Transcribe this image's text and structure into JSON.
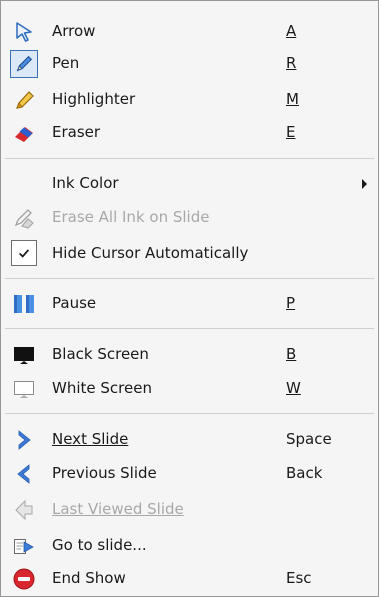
{
  "menu": {
    "tools": [
      {
        "label": "Arrow",
        "shortcut": "A",
        "icon": "arrow-cursor-icon"
      },
      {
        "label": "Pen",
        "shortcut": "R",
        "icon": "pen-icon"
      },
      {
        "label": "Highlighter",
        "shortcut": "M",
        "icon": "highlighter-icon"
      },
      {
        "label": "Eraser",
        "shortcut": "E",
        "icon": "eraser-icon"
      }
    ],
    "ink_color": {
      "label": "Ink Color"
    },
    "erase_all": {
      "label": "Erase All Ink on Slide"
    },
    "hide_cursor": {
      "label": "Hide Cursor Automatically",
      "checked": true
    },
    "pause": {
      "label": "Pause",
      "shortcut": "P"
    },
    "black_screen": {
      "label": "Black Screen",
      "shortcut": "B"
    },
    "white_screen": {
      "label": "White Screen",
      "shortcut": "W"
    },
    "next_slide": {
      "label": "Next Slide",
      "shortcut": "Space"
    },
    "previous_slide": {
      "label": "Previous Slide",
      "shortcut": "Back"
    },
    "last_viewed": {
      "label": "Last Viewed Slide"
    },
    "go_to_slide": {
      "label": "Go to slide..."
    },
    "end_show": {
      "label": "End Show",
      "shortcut": "Esc"
    }
  },
  "colors": {
    "menu_bg": "#f5f5f5",
    "border": "#979797",
    "disabled_text": "#a8a8a8",
    "accent_blue": "#3d7bd9",
    "end_red": "#d8272f"
  }
}
